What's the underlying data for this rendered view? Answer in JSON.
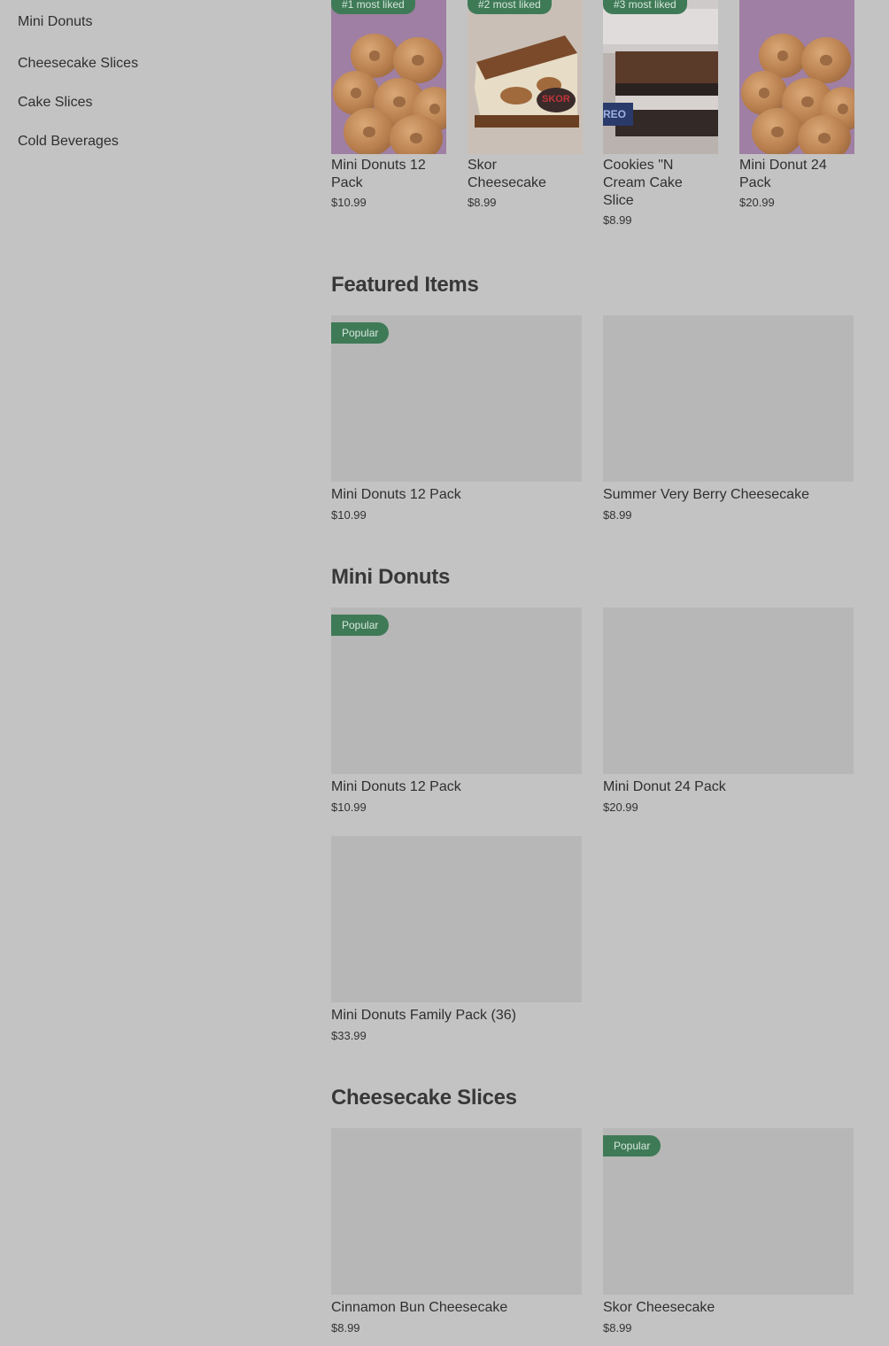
{
  "sidebar": {
    "items": [
      {
        "label": "Mini Donuts"
      },
      {
        "label": "Cheesecake Slices"
      },
      {
        "label": "Cake Slices"
      },
      {
        "label": "Cold Beverages"
      }
    ]
  },
  "most_liked": [
    {
      "badge": "#1 most liked",
      "name": "Mini Donuts 12 Pack",
      "price": "$10.99"
    },
    {
      "badge": "#2 most liked",
      "name": "Skor Cheesecake",
      "price": "$8.99",
      "logo": "SKOR"
    },
    {
      "badge": "#3 most liked",
      "name": "Cookies \"N Cream Cake Slice",
      "price": "$8.99",
      "logo": "REO"
    },
    {
      "badge": "",
      "name": "Mini Donut 24 Pack",
      "price": "$20.99"
    }
  ],
  "sections": {
    "featured": {
      "title": "Featured Items",
      "items": [
        {
          "name": "Mini Donuts 12 Pack",
          "price": "$10.99",
          "badge": "Popular"
        },
        {
          "name": "Summer Very Berry Cheesecake",
          "price": "$8.99",
          "badge": ""
        }
      ]
    },
    "mini_donuts": {
      "title": "Mini Donuts",
      "items": [
        {
          "name": "Mini Donuts 12 Pack",
          "price": "$10.99",
          "badge": "Popular"
        },
        {
          "name": "Mini Donut 24 Pack",
          "price": "$20.99",
          "badge": ""
        },
        {
          "name": "Mini Donuts Family Pack (36)",
          "price": "$33.99",
          "badge": ""
        }
      ]
    },
    "cheesecake": {
      "title": "Cheesecake Slices",
      "items": [
        {
          "name": "Cinnamon Bun Cheesecake",
          "price": "$8.99",
          "badge": ""
        },
        {
          "name": "Skor Cheesecake",
          "price": "$8.99",
          "badge": "Popular"
        }
      ]
    }
  },
  "colors": {
    "overlay_bg": "#c3c3c3",
    "badge_green": "#3f7a57",
    "image_placeholder": "#b7b7b7"
  }
}
